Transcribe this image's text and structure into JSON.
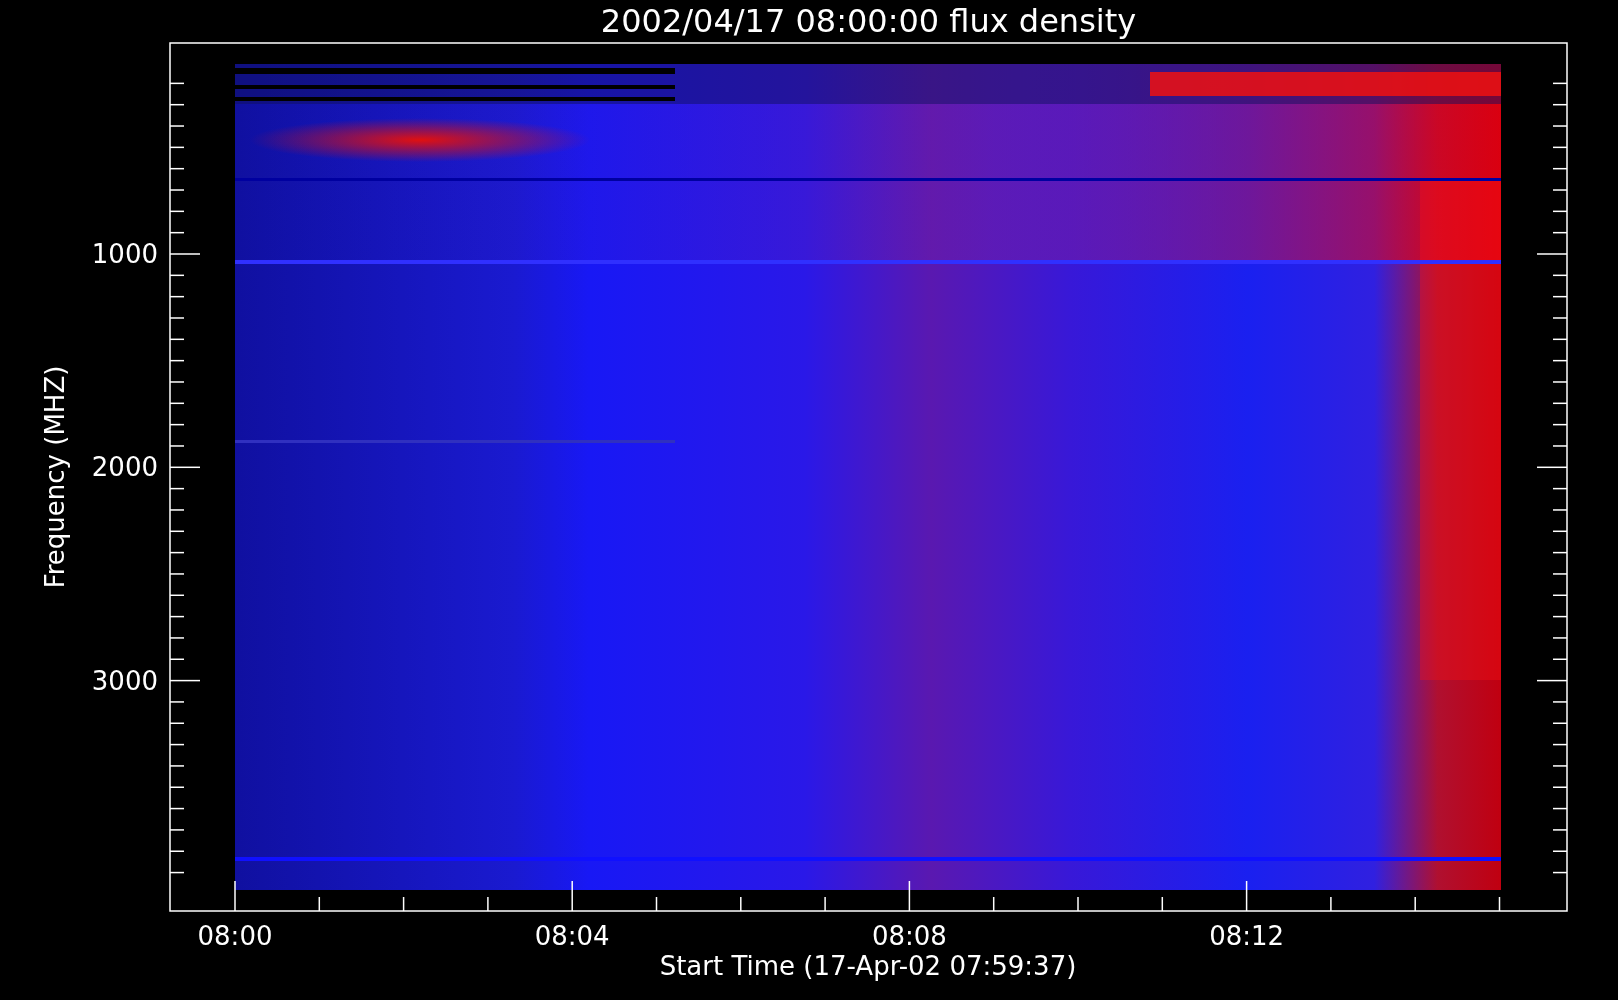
{
  "plot": {
    "title": "2002/04/17 08:00:00 flux density",
    "xlabel": "Start Time (17-Apr-02 07:59:37)",
    "ylabel": "Frequency (MHZ)",
    "x_tick_labels": [
      "08:00",
      "08:04",
      "08:08",
      "08:12"
    ],
    "y_tick_labels": [
      "1000",
      "2000",
      "3000"
    ]
  }
}
